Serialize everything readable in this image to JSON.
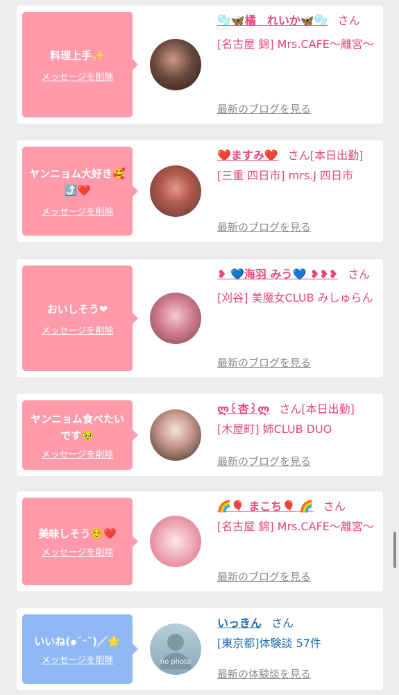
{
  "cards": [
    {
      "message": "料理上手✨",
      "delete_label": "メッセージを削除",
      "name": "🫧🦋橘　れいか🦋🫧",
      "honorific": "さん",
      "shop": "[名古屋 錦] Mrs.CAFE〜離宮〜",
      "link": "最新のブログを見る",
      "color": "#ff9aaa"
    },
    {
      "message": "ヤンニョム大好き🥰⤴️❤️",
      "delete_label": "メッセージを削除",
      "name": "❤️ますみ❤️",
      "honorific": "さん",
      "status": "[本日出勤]",
      "shop": "[三重 四日市] mrs.J 四日市",
      "link": "最新のブログを見る",
      "color": "#ff9aaa"
    },
    {
      "message": "おいしそう❤",
      "delete_label": "メッセージを削除",
      "name": "❥ 💙海羽 みう💙 ❥❥❥",
      "honorific": "さん",
      "shop": "[刈谷] 美魔女CLUB みしゅらん",
      "link": "最新のブログを見る",
      "color": "#ff9aaa"
    },
    {
      "message": "ヤンニョム食べたいです🥹",
      "delete_label": "メッセージを削除",
      "name": "ლ꒰杏꒱ლ",
      "honorific": "さん",
      "status": "[本日出勤]",
      "shop": "[木屋町] 姉CLUB DUO",
      "link": "最新のブログを見る",
      "color": "#ff9aaa"
    },
    {
      "message": "美味しそう☺️❤️",
      "delete_label": "メッセージを削除",
      "name": "🌈🎈 まこち🎈 🌈",
      "honorific": "さん",
      "shop": "[名古屋 錦] Mrs.CAFE〜離宮〜",
      "link": "最新のブログを見る",
      "color": "#ff9aaa"
    },
    {
      "message": "いいね(๑˘ᵕ˘)／🌟",
      "delete_label": "メッセージを削除",
      "name": "いっきん",
      "honorific": "さん",
      "shop": "[東京都]体験談 57件",
      "link": "最新の体験談を見る",
      "avatar_text": "no photo",
      "color": "#8fb8f4"
    }
  ]
}
